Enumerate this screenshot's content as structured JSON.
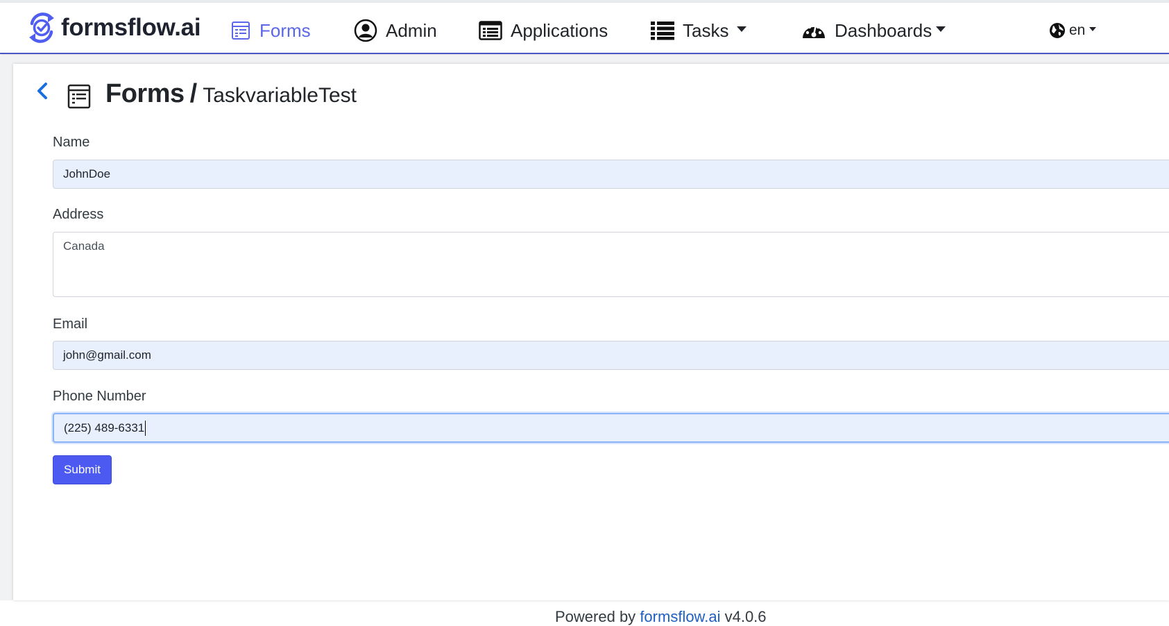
{
  "navbar": {
    "brand": "formsflow.ai",
    "items": [
      {
        "label": "Forms",
        "icon": "forms-icon",
        "active": true
      },
      {
        "label": "Admin",
        "icon": "user-circle-icon",
        "active": false
      },
      {
        "label": "Applications",
        "icon": "list-alt-icon",
        "active": false
      },
      {
        "label": "Tasks",
        "icon": "list-icon",
        "active": false
      },
      {
        "label": "Dashboards",
        "icon": "tachometer-icon",
        "active": false
      }
    ],
    "language": "en"
  },
  "colors": {
    "accent": "#5b67e8",
    "button": "#4c5af2",
    "autofill": "#e8f0fe",
    "link": "#1f5fbf"
  },
  "page": {
    "breadcrumb_root": "Forms",
    "separator": "/",
    "form_name": "TaskvariableTest"
  },
  "form": {
    "fields": [
      {
        "label": "Name",
        "value": "JohnDoe"
      },
      {
        "label": "Address",
        "value": "Canada"
      },
      {
        "label": "Email",
        "value": "john@gmail.com"
      },
      {
        "label": "Phone Number",
        "value": "(225) 489-6331"
      }
    ],
    "submit_label": "Submit"
  },
  "footer": {
    "prefix": "Powered by",
    "link_text": "formsflow.ai",
    "version": "v4.0.6"
  }
}
